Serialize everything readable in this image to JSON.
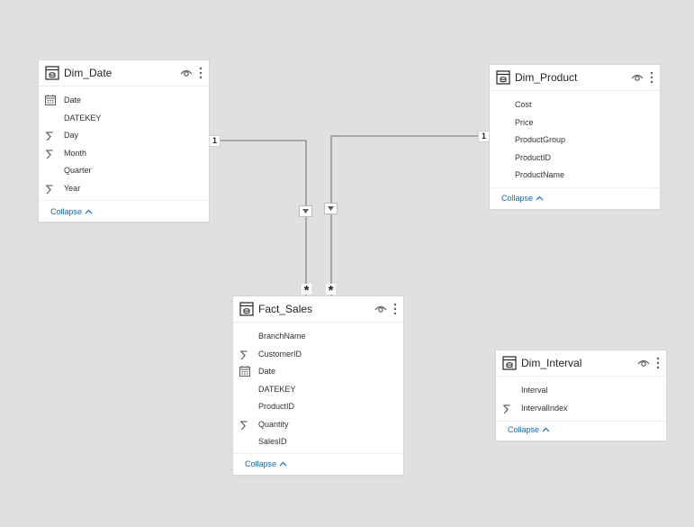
{
  "tables": {
    "dim_date": {
      "title": "Dim_Date",
      "fields": [
        {
          "name": "Date",
          "icon": "calendar-icon"
        },
        {
          "name": "DATEKEY",
          "icon": ""
        },
        {
          "name": "Day",
          "icon": "sigma-icon"
        },
        {
          "name": "Month",
          "icon": "sigma-icon"
        },
        {
          "name": "Quarter",
          "icon": ""
        },
        {
          "name": "Year",
          "icon": "sigma-icon"
        }
      ],
      "collapse": "Collapse"
    },
    "dim_product": {
      "title": "Dim_Product",
      "fields": [
        {
          "name": "Cost",
          "icon": ""
        },
        {
          "name": "Price",
          "icon": ""
        },
        {
          "name": "ProductGroup",
          "icon": ""
        },
        {
          "name": "ProductID",
          "icon": ""
        },
        {
          "name": "ProductName",
          "icon": ""
        }
      ],
      "collapse": "Collapse"
    },
    "fact_sales": {
      "title": "Fact_Sales",
      "fields": [
        {
          "name": "BranchName",
          "icon": ""
        },
        {
          "name": "CustomerID",
          "icon": "sigma-icon"
        },
        {
          "name": "Date",
          "icon": "calendar-icon"
        },
        {
          "name": "DATEKEY",
          "icon": ""
        },
        {
          "name": "ProductID",
          "icon": ""
        },
        {
          "name": "Quantity",
          "icon": "sigma-icon"
        },
        {
          "name": "SalesID",
          "icon": ""
        }
      ],
      "collapse": "Collapse"
    },
    "dim_interval": {
      "title": "Dim_Interval",
      "fields": [
        {
          "name": "Interval",
          "icon": ""
        },
        {
          "name": "IntervalIndex",
          "icon": "sigma-icon"
        }
      ],
      "collapse": "Collapse"
    }
  },
  "relationships": [
    {
      "from": "Dim_Date",
      "to": "Fact_Sales",
      "from_cardinality": "1",
      "to_cardinality": "*"
    },
    {
      "from": "Dim_Product",
      "to": "Fact_Sales",
      "from_cardinality": "1",
      "to_cardinality": "*"
    }
  ],
  "colors": {
    "canvas": "#e1e0df",
    "card": "#ffffff",
    "link": "#0f6cbd",
    "line": "#8a8886"
  }
}
